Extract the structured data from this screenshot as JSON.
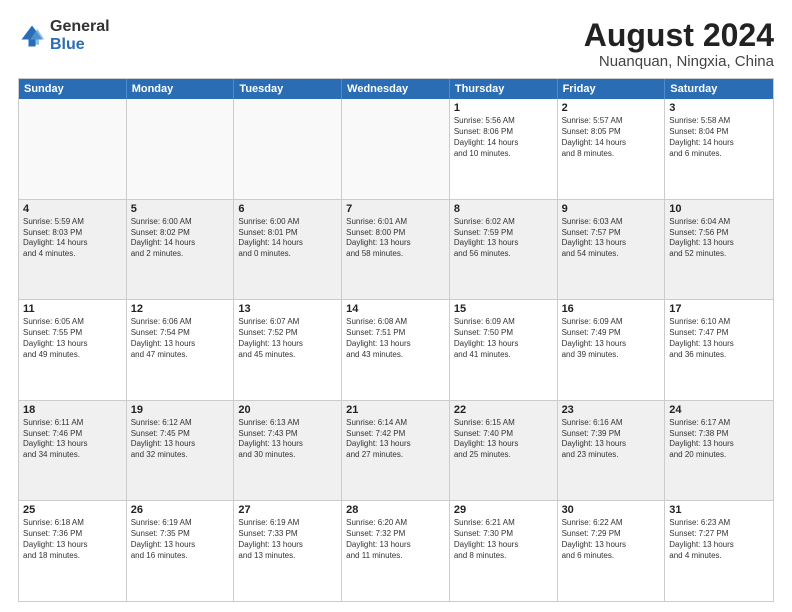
{
  "logo": {
    "general": "General",
    "blue": "Blue"
  },
  "title": "August 2024",
  "subtitle": "Nuanquan, Ningxia, China",
  "days": [
    "Sunday",
    "Monday",
    "Tuesday",
    "Wednesday",
    "Thursday",
    "Friday",
    "Saturday"
  ],
  "weeks": [
    [
      {
        "day": "",
        "info": ""
      },
      {
        "day": "",
        "info": ""
      },
      {
        "day": "",
        "info": ""
      },
      {
        "day": "",
        "info": ""
      },
      {
        "day": "1",
        "info": "Sunrise: 5:56 AM\nSunset: 8:06 PM\nDaylight: 14 hours\nand 10 minutes."
      },
      {
        "day": "2",
        "info": "Sunrise: 5:57 AM\nSunset: 8:05 PM\nDaylight: 14 hours\nand 8 minutes."
      },
      {
        "day": "3",
        "info": "Sunrise: 5:58 AM\nSunset: 8:04 PM\nDaylight: 14 hours\nand 6 minutes."
      }
    ],
    [
      {
        "day": "4",
        "info": "Sunrise: 5:59 AM\nSunset: 8:03 PM\nDaylight: 14 hours\nand 4 minutes."
      },
      {
        "day": "5",
        "info": "Sunrise: 6:00 AM\nSunset: 8:02 PM\nDaylight: 14 hours\nand 2 minutes."
      },
      {
        "day": "6",
        "info": "Sunrise: 6:00 AM\nSunset: 8:01 PM\nDaylight: 14 hours\nand 0 minutes."
      },
      {
        "day": "7",
        "info": "Sunrise: 6:01 AM\nSunset: 8:00 PM\nDaylight: 13 hours\nand 58 minutes."
      },
      {
        "day": "8",
        "info": "Sunrise: 6:02 AM\nSunset: 7:59 PM\nDaylight: 13 hours\nand 56 minutes."
      },
      {
        "day": "9",
        "info": "Sunrise: 6:03 AM\nSunset: 7:57 PM\nDaylight: 13 hours\nand 54 minutes."
      },
      {
        "day": "10",
        "info": "Sunrise: 6:04 AM\nSunset: 7:56 PM\nDaylight: 13 hours\nand 52 minutes."
      }
    ],
    [
      {
        "day": "11",
        "info": "Sunrise: 6:05 AM\nSunset: 7:55 PM\nDaylight: 13 hours\nand 49 minutes."
      },
      {
        "day": "12",
        "info": "Sunrise: 6:06 AM\nSunset: 7:54 PM\nDaylight: 13 hours\nand 47 minutes."
      },
      {
        "day": "13",
        "info": "Sunrise: 6:07 AM\nSunset: 7:52 PM\nDaylight: 13 hours\nand 45 minutes."
      },
      {
        "day": "14",
        "info": "Sunrise: 6:08 AM\nSunset: 7:51 PM\nDaylight: 13 hours\nand 43 minutes."
      },
      {
        "day": "15",
        "info": "Sunrise: 6:09 AM\nSunset: 7:50 PM\nDaylight: 13 hours\nand 41 minutes."
      },
      {
        "day": "16",
        "info": "Sunrise: 6:09 AM\nSunset: 7:49 PM\nDaylight: 13 hours\nand 39 minutes."
      },
      {
        "day": "17",
        "info": "Sunrise: 6:10 AM\nSunset: 7:47 PM\nDaylight: 13 hours\nand 36 minutes."
      }
    ],
    [
      {
        "day": "18",
        "info": "Sunrise: 6:11 AM\nSunset: 7:46 PM\nDaylight: 13 hours\nand 34 minutes."
      },
      {
        "day": "19",
        "info": "Sunrise: 6:12 AM\nSunset: 7:45 PM\nDaylight: 13 hours\nand 32 minutes."
      },
      {
        "day": "20",
        "info": "Sunrise: 6:13 AM\nSunset: 7:43 PM\nDaylight: 13 hours\nand 30 minutes."
      },
      {
        "day": "21",
        "info": "Sunrise: 6:14 AM\nSunset: 7:42 PM\nDaylight: 13 hours\nand 27 minutes."
      },
      {
        "day": "22",
        "info": "Sunrise: 6:15 AM\nSunset: 7:40 PM\nDaylight: 13 hours\nand 25 minutes."
      },
      {
        "day": "23",
        "info": "Sunrise: 6:16 AM\nSunset: 7:39 PM\nDaylight: 13 hours\nand 23 minutes."
      },
      {
        "day": "24",
        "info": "Sunrise: 6:17 AM\nSunset: 7:38 PM\nDaylight: 13 hours\nand 20 minutes."
      }
    ],
    [
      {
        "day": "25",
        "info": "Sunrise: 6:18 AM\nSunset: 7:36 PM\nDaylight: 13 hours\nand 18 minutes."
      },
      {
        "day": "26",
        "info": "Sunrise: 6:19 AM\nSunset: 7:35 PM\nDaylight: 13 hours\nand 16 minutes."
      },
      {
        "day": "27",
        "info": "Sunrise: 6:19 AM\nSunset: 7:33 PM\nDaylight: 13 hours\nand 13 minutes."
      },
      {
        "day": "28",
        "info": "Sunrise: 6:20 AM\nSunset: 7:32 PM\nDaylight: 13 hours\nand 11 minutes."
      },
      {
        "day": "29",
        "info": "Sunrise: 6:21 AM\nSunset: 7:30 PM\nDaylight: 13 hours\nand 8 minutes."
      },
      {
        "day": "30",
        "info": "Sunrise: 6:22 AM\nSunset: 7:29 PM\nDaylight: 13 hours\nand 6 minutes."
      },
      {
        "day": "31",
        "info": "Sunrise: 6:23 AM\nSunset: 7:27 PM\nDaylight: 13 hours\nand 4 minutes."
      }
    ]
  ]
}
